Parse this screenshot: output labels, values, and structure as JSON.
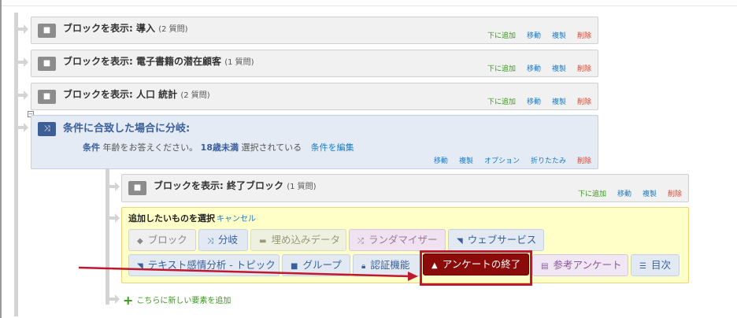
{
  "blocks": [
    {
      "prefix": "ブロックを表示: ",
      "name": "導入",
      "count": "(2 質問)"
    },
    {
      "prefix": "ブロックを表示: ",
      "name": "電子書籍の潜在顧客",
      "count": "(1 質問)"
    },
    {
      "prefix": "ブロックを表示: ",
      "name": "人口 統計",
      "count": "(2 質問)"
    }
  ],
  "block_actions": {
    "add_below": "下に追加",
    "move": "移動",
    "copy": "複製",
    "delete": "削除"
  },
  "branch": {
    "title": "条件に合致した場合に分岐:",
    "condition_label": "条件",
    "question": "年齢をお答えください。",
    "answer": "18歳未満",
    "state": "選択されている",
    "edit": "条件を編集",
    "actions": {
      "move": "移動",
      "copy": "複製",
      "options": "オプション",
      "collapse": "折りたたみ",
      "delete": "削除"
    }
  },
  "inner_block": {
    "prefix": "ブロックを表示: ",
    "name": "終了ブロック",
    "count": "(1 質問)"
  },
  "chooser": {
    "title": "追加したいものを選択",
    "cancel": "キャンセル",
    "options": [
      "ブロック",
      "分岐",
      "埋め込みデータ",
      "ランダマイザー",
      "ウェブサービス",
      "テキスト感情分析 - トピック",
      "グループ",
      "認証機能",
      "アンケートの終了",
      "参考アンケート",
      "目次"
    ]
  },
  "add_new": "こちらに新しい要素を追加",
  "colors": {
    "highlight": "#c0182e",
    "end_button": "#8b0a0a",
    "green": "#3a9a1a",
    "blue": "#1a7bc4",
    "red": "#d9432a"
  }
}
